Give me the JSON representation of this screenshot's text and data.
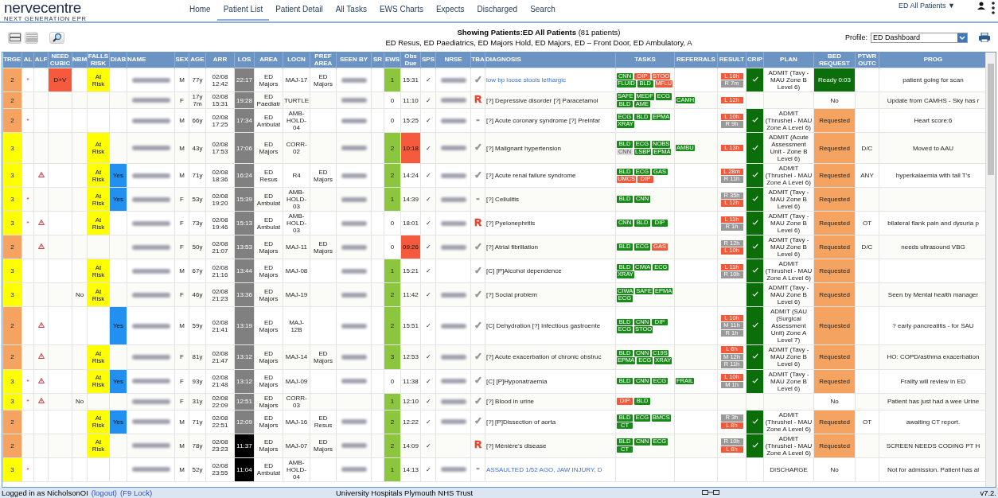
{
  "logo": {
    "name": "nervecentre",
    "tagline": "NEXT GENERATION EPR"
  },
  "nav": [
    {
      "label": "Home",
      "selected": false
    },
    {
      "label": "Patient List",
      "selected": true
    },
    {
      "label": "Patient Detail",
      "selected": false
    },
    {
      "label": "All Tasks",
      "selected": false
    },
    {
      "label": "EWS Charts",
      "selected": false
    },
    {
      "label": "Expects",
      "selected": false
    },
    {
      "label": "Discharged",
      "selected": false
    },
    {
      "label": "Search",
      "selected": false
    }
  ],
  "list_selector": "ED All Patients ▼",
  "heading": {
    "title": "Showing Patients:ED All Patients",
    "count": "(81 patients)",
    "areas": "ED Resus, ED Paediatrics, ED Majors Hold, ED Majors, ED – Front Door, ED Ambulatory, A"
  },
  "profile": {
    "label": "Profile:",
    "value": "ED Dashboard"
  },
  "table": {
    "columns": [
      "TRGE",
      "AL",
      "ALF",
      "NEED CUBIC",
      "NBM",
      "FALLS RISK",
      "DIAB",
      "NAME",
      "SEX",
      "AGE",
      "ARR",
      "LOS",
      "AREA",
      "LOCN",
      "PREF AREA",
      "SEEN BY",
      "SR",
      "EWS",
      "Obs Due",
      "SPS",
      "NRSE",
      "TBA",
      "DIAGNOSIS",
      "TASKS",
      "REFERRALS",
      "RESULT",
      "CRIP",
      "PLAN",
      "BED REQUEST",
      "PTWR OUTC",
      "PROG"
    ],
    "rows": [
      {
        "trge": {
          "text": "2",
          "color": "#f4a460"
        },
        "alc": "*",
        "alert": false,
        "need_cubicle": "D+V",
        "nbm": "",
        "falls_risk": "At Risk",
        "diab": "",
        "sex": "M",
        "age": "77y",
        "arr": "02/08 12:42",
        "los": {
          "text": "22:17",
          "color": "#808080"
        },
        "area": "ED Majors",
        "locn": "MAJ-17",
        "pref_area": "ED Majors",
        "seen_by_redacted": true,
        "ews": {
          "text": "1",
          "color": "#8cc63f"
        },
        "obs_due": "15:31",
        "obs_overdue": false,
        "sps": "✓",
        "nurse_redacted": true,
        "tba": {
          "text": "✓",
          "color": "#999999"
        },
        "diagnosis": "low bp loose stools lethargic",
        "diagnosis_link": true,
        "tasks": [
          {
            "label": "CNN",
            "color": "#1a8a1a"
          },
          {
            "label": "DIP",
            "color": "#f05a3c"
          },
          {
            "label": "STOO",
            "color": "#f05a3c"
          },
          {
            "label": "FLUID",
            "color": "#1a8a1a"
          },
          {
            "label": "BLD",
            "color": "#1a8a1a"
          },
          {
            "label": "MFLU",
            "color": "#f05a3c"
          }
        ],
        "referrals": [],
        "results": [
          {
            "label": "L 18h",
            "color": "#f05a3c"
          },
          {
            "label": "R 7m",
            "color": "#999999"
          }
        ],
        "crip": true,
        "plan": "ADMIT (Tavy - MAU Zone B Level 6)",
        "bed_request": {
          "text": "Ready 0:03",
          "color": "#0b6e0b"
        },
        "ptwr": "",
        "prog": "patient going for scan"
      },
      {
        "trge": {
          "text": "2",
          "color": "#f4a460"
        },
        "alc": "",
        "alert": false,
        "need_cubicle": "",
        "nbm": "",
        "falls_risk": "",
        "diab": "",
        "sex": "F",
        "age": "17y 7m",
        "arr": "02/08 15:31",
        "los": {
          "text": "19:28",
          "color": "#808080"
        },
        "area": "ED Paediatr",
        "locn": "TURTLE",
        "pref_area": "",
        "seen_by_redacted": true,
        "ews": {
          "text": "0",
          "color": "#ffffff"
        },
        "obs_due": "11:10",
        "obs_overdue": false,
        "sps": "✓",
        "nurse_redacted": true,
        "tba": {
          "text": "R",
          "color": "#e8402a"
        },
        "diagnosis": "[?] Depressive disorder [?] Paracetamol",
        "diagnosis_link": false,
        "tasks": [
          {
            "label": "SAFE",
            "color": "#1a8a1a"
          },
          {
            "label": "MEDF",
            "color": "#1a8a1a"
          },
          {
            "label": "ECG",
            "color": "#1a8a1a"
          },
          {
            "label": "BLD",
            "color": "#1a8a1a"
          },
          {
            "label": "AME",
            "color": "#1a8a1a"
          }
        ],
        "referrals": [
          "CAMH"
        ],
        "results": [
          {
            "label": "L 12h",
            "color": "#f05a3c"
          }
        ],
        "crip": false,
        "plan": "",
        "bed_request": {
          "text": "No",
          "color": "#ffffff"
        },
        "ptwr": "",
        "prog": "Update from CAMHS - Sky has r"
      },
      {
        "trge": {
          "text": "2",
          "color": "#f4a460"
        },
        "alc": "*",
        "alert": false,
        "need_cubicle": "",
        "nbm": "",
        "falls_risk": "",
        "diab": "",
        "sex": "M",
        "age": "66y",
        "arr": "02/08 17:25",
        "los": {
          "text": "17:34",
          "color": "#808080"
        },
        "area": "ED Ambulat",
        "locn": "AMB-HOLD-04",
        "pref_area": "",
        "seen_by_redacted": true,
        "ews": {
          "text": "0",
          "color": "#ffffff"
        },
        "obs_due": "15:25",
        "obs_overdue": false,
        "sps": "✓",
        "nurse_redacted": true,
        "tba": {
          "text": "-",
          "color": "#999999"
        },
        "diagnosis": "[?] Acute coronary syndrome [?] Preinfar",
        "diagnosis_link": false,
        "tasks": [
          {
            "label": "ECG",
            "color": "#1a8a1a"
          },
          {
            "label": "BLD",
            "color": "#1a8a1a"
          },
          {
            "label": "EPMA",
            "color": "#1a8a1a"
          },
          {
            "label": "XRAY",
            "color": "#1a8a1a"
          }
        ],
        "referrals": [],
        "results": [
          {
            "label": "L 10h",
            "color": "#f05a3c"
          },
          {
            "label": "R 9h",
            "color": "#999999"
          }
        ],
        "crip": true,
        "plan": "ADMIT (Thrushel - MAU Zone A Level 6)",
        "bed_request": {
          "text": "Requested",
          "color": "#f4a460"
        },
        "ptwr": "",
        "prog": "Heart score:6"
      },
      {
        "trge": {
          "text": "3",
          "color": "#ffff00"
        },
        "alc": "",
        "alert": false,
        "need_cubicle": "",
        "nbm": "",
        "falls_risk": "At Risk",
        "diab": "",
        "sex": "M",
        "age": "43y",
        "arr": "02/08 17:53",
        "los": {
          "text": "17:06",
          "color": "#808080"
        },
        "area": "ED Majors",
        "locn": "CORR-02",
        "pref_area": "",
        "seen_by_redacted": true,
        "ews": {
          "text": "2",
          "color": "#8cc63f"
        },
        "obs_due": "10:18",
        "obs_overdue": true,
        "sps": "✓",
        "nurse_redacted": true,
        "tba": {
          "text": "✓",
          "color": "#999999"
        },
        "diagnosis": "[?] Malignant hypertension",
        "diagnosis_link": false,
        "tasks": [
          {
            "label": "BLD",
            "color": "#1a8a1a"
          },
          {
            "label": "ECG",
            "color": "#1a8a1a"
          },
          {
            "label": "NOBS",
            "color": "#1a8a1a"
          },
          {
            "label": "CNN",
            "color": "#dddddd"
          },
          {
            "label": "LSBP",
            "color": "#1a8a1a"
          },
          {
            "label": "EPMA",
            "color": "#1a8a1a"
          }
        ],
        "referrals": [
          "AMBU"
        ],
        "results": [
          {
            "label": "L 13h",
            "color": "#f05a3c"
          }
        ],
        "crip": true,
        "plan": "ADMIT (Acute Assessment Unit - Zone B Level 6)",
        "bed_request": {
          "text": "Requested",
          "color": "#f4a460"
        },
        "ptwr": "D/C",
        "prog": "Moved to AAU"
      },
      {
        "trge": {
          "text": "3",
          "color": "#ffff00"
        },
        "alc": "",
        "alert": true,
        "need_cubicle": "",
        "nbm": "",
        "falls_risk": "At Risk",
        "diab": "Yes",
        "sex": "M",
        "age": "71y",
        "arr": "02/08 18:36",
        "los": {
          "text": "16:24",
          "color": "#808080"
        },
        "area": "ED Resus",
        "locn": "R4",
        "pref_area": "ED Majors",
        "seen_by_redacted": true,
        "ews": {
          "text": "2",
          "color": "#8cc63f"
        },
        "obs_due": "14:24",
        "obs_overdue": false,
        "sps": "✓",
        "nurse_redacted": true,
        "tba": {
          "text": "✓",
          "color": "#999999"
        },
        "diagnosis": "[?] Acute renal failure syndrome",
        "diagnosis_link": false,
        "tasks": [
          {
            "label": "BLD",
            "color": "#1a8a1a"
          },
          {
            "label": "ECG",
            "color": "#1a8a1a"
          },
          {
            "label": "GAS",
            "color": "#1a8a1a"
          },
          {
            "label": "UMCS",
            "color": "#f05a3c"
          },
          {
            "label": "DIP",
            "color": "#f05a3c"
          }
        ],
        "referrals": [],
        "results": [
          {
            "label": "L 28m",
            "color": "#f05a3c"
          },
          {
            "label": "R 11h",
            "color": "#999999"
          }
        ],
        "crip": true,
        "plan": "ADMIT (Thrushel - MAU Zone A Level 6)",
        "bed_request": {
          "text": "Requested",
          "color": "#f4a460"
        },
        "ptwr": "ANY",
        "prog": "hyperkalaemia with tall T's"
      },
      {
        "trge": {
          "text": "3",
          "color": "#ffff00"
        },
        "alc": "*",
        "alert": false,
        "need_cubicle": "",
        "nbm": "",
        "falls_risk": "At Risk",
        "diab": "Yes",
        "sex": "F",
        "age": "53y",
        "arr": "02/08 19:20",
        "los": {
          "text": "15:39",
          "color": "#808080"
        },
        "area": "ED Ambulat",
        "locn": "AMB-HOLD-03",
        "pref_area": "",
        "seen_by_redacted": true,
        "ews": {
          "text": "1",
          "color": "#8cc63f"
        },
        "obs_due": "14:39",
        "obs_overdue": false,
        "sps": "✓",
        "nurse_redacted": true,
        "tba": {
          "text": "-",
          "color": "#999999"
        },
        "diagnosis": "[?] Cellulitis",
        "diagnosis_link": false,
        "tasks": [
          {
            "label": "BLD",
            "color": "#1a8a1a"
          },
          {
            "label": "CNN",
            "color": "#1a8a1a"
          }
        ],
        "referrals": [],
        "results": [
          {
            "label": "R 35h",
            "color": "#999999"
          },
          {
            "label": "L 12h",
            "color": "#f05a3c"
          }
        ],
        "crip": true,
        "plan": "ADMIT (Tavy - MAU Zone B Level 6)",
        "bed_request": {
          "text": "Requested",
          "color": "#f4a460"
        },
        "ptwr": "",
        "prog": ""
      },
      {
        "trge": {
          "text": "3",
          "color": "#ffff00"
        },
        "alc": "*",
        "alert": true,
        "need_cubicle": "",
        "nbm": "",
        "falls_risk": "At Risk",
        "diab": "",
        "sex": "F",
        "age": "73y",
        "arr": "02/08 19:46",
        "los": {
          "text": "15:13",
          "color": "#808080"
        },
        "area": "ED Ambulat",
        "locn": "AMB-HOLD-03",
        "pref_area": "",
        "seen_by_redacted": true,
        "ews": {
          "text": "0",
          "color": "#ffffff"
        },
        "obs_due": "18:01",
        "obs_overdue": false,
        "sps": "✓",
        "nurse_redacted": true,
        "tba": {
          "text": "R",
          "color": "#e8402a"
        },
        "diagnosis": "[?] Pyelonephritis",
        "diagnosis_link": false,
        "tasks": [
          {
            "label": "CNN",
            "color": "#1a8a1a"
          },
          {
            "label": "BLD",
            "color": "#1a8a1a"
          },
          {
            "label": "DIP",
            "color": "#1a8a1a"
          }
        ],
        "referrals": [],
        "results": [
          {
            "label": "L 11h",
            "color": "#f05a3c"
          },
          {
            "label": "R 1h",
            "color": "#999999"
          }
        ],
        "crip": true,
        "plan": "ADMIT (Tavy - MAU Zone B Level 6)",
        "bed_request": {
          "text": "Requested",
          "color": "#f4a460"
        },
        "ptwr": "OT",
        "prog": "bilateral flank pain and dysuria p"
      },
      {
        "trge": {
          "text": "2",
          "color": "#f4a460"
        },
        "alc": "",
        "alert": true,
        "need_cubicle": "",
        "nbm": "",
        "falls_risk": "",
        "diab": "",
        "sex": "F",
        "age": "50y",
        "arr": "02/08 21:07",
        "los": {
          "text": "13:53",
          "color": "#808080"
        },
        "area": "ED Majors",
        "locn": "MAJ-11",
        "pref_area": "ED Majors",
        "seen_by_redacted": true,
        "ews": {
          "text": "0",
          "color": "#ffffff"
        },
        "obs_due": "09:26",
        "obs_overdue": true,
        "sps": "✓",
        "nurse_redacted": true,
        "tba": {
          "text": "✓",
          "color": "#999999"
        },
        "diagnosis": "[?] Atrial fibrillation",
        "diagnosis_link": false,
        "tasks": [
          {
            "label": "BLD",
            "color": "#1a8a1a"
          },
          {
            "label": "ECG",
            "color": "#1a8a1a"
          },
          {
            "label": "GAS",
            "color": "#f05a3c"
          }
        ],
        "referrals": [],
        "results": [
          {
            "label": "R 12h",
            "color": "#999999"
          },
          {
            "label": "L 10h",
            "color": "#f05a3c"
          }
        ],
        "crip": true,
        "plan": "ADMIT (Tavy - MAU Zone B Level 6)",
        "bed_request": {
          "text": "Requested",
          "color": "#f4a460"
        },
        "ptwr": "D/C",
        "prog": "needs ultrasound VBG"
      },
      {
        "trge": {
          "text": "3",
          "color": "#ffff00"
        },
        "alc": "",
        "alert": false,
        "need_cubicle": "",
        "nbm": "",
        "falls_risk": "At Risk",
        "diab": "",
        "sex": "M",
        "age": "67y",
        "arr": "02/08 21:16",
        "los": {
          "text": "13:44",
          "color": "#808080"
        },
        "area": "ED Majors",
        "locn": "MAJ-08",
        "pref_area": "",
        "seen_by_redacted": true,
        "ews": {
          "text": "1",
          "color": "#8cc63f"
        },
        "obs_due": "15:21",
        "obs_overdue": false,
        "sps": "✓",
        "nurse_redacted": false,
        "tba": {
          "text": "✓",
          "color": "#999999"
        },
        "diagnosis": "[C] [P]Alcohol dependence",
        "diagnosis_link": false,
        "tasks": [
          {
            "label": "BLD",
            "color": "#1a8a1a"
          },
          {
            "label": "CIWA",
            "color": "#1a8a1a"
          },
          {
            "label": "ECG",
            "color": "#1a8a1a"
          },
          {
            "label": "XRAY",
            "color": "#1a8a1a"
          }
        ],
        "referrals": [],
        "results": [
          {
            "label": "L 11h",
            "color": "#f05a3c"
          },
          {
            "label": "R 10h",
            "color": "#999999"
          }
        ],
        "crip": true,
        "plan": "ADMIT (Thrushel - MAU Zone A Level 6)",
        "bed_request": {
          "text": "Requested",
          "color": "#f4a460"
        },
        "ptwr": "",
        "prog": ""
      },
      {
        "trge": {
          "text": "3",
          "color": "#ffff00"
        },
        "alc": "",
        "alert": false,
        "need_cubicle": "",
        "nbm": "No",
        "falls_risk": "At Risk",
        "diab": "",
        "sex": "F",
        "age": "46y",
        "arr": "02/08 21:23",
        "los": {
          "text": "13:36",
          "color": "#808080"
        },
        "area": "ED Majors",
        "locn": "MAJ-19",
        "pref_area": "",
        "seen_by_redacted": true,
        "ews": {
          "text": "2",
          "color": "#8cc63f"
        },
        "obs_due": "11:42",
        "obs_overdue": false,
        "sps": "✓",
        "nurse_redacted": true,
        "tba": {
          "text": "✓",
          "color": "#999999"
        },
        "diagnosis": "[?] Social problem",
        "diagnosis_link": false,
        "tasks": [
          {
            "label": "CIWA",
            "color": "#1a8a1a"
          },
          {
            "label": "SAFE",
            "color": "#1a8a1a"
          },
          {
            "label": "EPMA",
            "color": "#1a8a1a"
          },
          {
            "label": "ECG",
            "color": "#1a8a1a"
          }
        ],
        "referrals": [],
        "results": [],
        "crip": true,
        "plan": "ADMIT (Tavy - MAU Zone B Level 6)",
        "bed_request": {
          "text": "Requested",
          "color": "#f4a460"
        },
        "ptwr": "",
        "prog": "Seen by Mental health manager"
      },
      {
        "trge": {
          "text": "2",
          "color": "#f4a460"
        },
        "alc": "",
        "alert": true,
        "need_cubicle": "",
        "nbm": "",
        "falls_risk": "",
        "diab": "Yes",
        "sex": "M",
        "age": "59y",
        "arr": "02/08 21:41",
        "los": {
          "text": "13:19",
          "color": "#808080"
        },
        "area": "ED Majors",
        "locn": "MAJ-12B",
        "pref_area": "",
        "seen_by_redacted": true,
        "ews": {
          "text": "2",
          "color": "#8cc63f"
        },
        "obs_due": "15:51",
        "obs_overdue": false,
        "sps": "✓",
        "nurse_redacted": true,
        "tba": {
          "text": "✓",
          "color": "#999999"
        },
        "diagnosis": "[C] Dehydration [?] Infectious gastroente",
        "diagnosis_link": false,
        "tasks": [
          {
            "label": "BLD",
            "color": "#1a8a1a"
          },
          {
            "label": "CNN",
            "color": "#1a8a1a"
          },
          {
            "label": "DIP",
            "color": "#1a8a1a"
          },
          {
            "label": "ECG",
            "color": "#1a8a1a"
          },
          {
            "label": "STOO",
            "color": "#1a8a1a"
          }
        ],
        "referrals": [],
        "results": [
          {
            "label": "L 10h",
            "color": "#f05a3c"
          },
          {
            "label": "M 11h",
            "color": "#999999"
          },
          {
            "label": "R 1h",
            "color": "#999999"
          }
        ],
        "crip": true,
        "plan": "ADMIT (SAU (Surgical Assessment Unit) Zone A Level 7)",
        "bed_request": {
          "text": "Requested",
          "color": "#f4a460"
        },
        "ptwr": "",
        "prog": "? early pancreatitis - for SAU"
      },
      {
        "trge": {
          "text": "2",
          "color": "#f4a460"
        },
        "alc": "",
        "alert": true,
        "need_cubicle": "",
        "nbm": "",
        "falls_risk": "At Risk",
        "diab": "",
        "sex": "F",
        "age": "81y",
        "arr": "02/08 21:47",
        "los": {
          "text": "13:12",
          "color": "#808080"
        },
        "area": "ED Majors",
        "locn": "MAJ-14",
        "pref_area": "ED Majors",
        "seen_by_redacted": true,
        "ews": {
          "text": "3",
          "color": "#8cc63f"
        },
        "obs_due": "12:53",
        "obs_overdue": false,
        "sps": "✓",
        "nurse_redacted": true,
        "tba": {
          "text": "✓",
          "color": "#999999"
        },
        "diagnosis": "[?] Acute exacerbation of chronic obstruc",
        "diagnosis_link": false,
        "tasks": [
          {
            "label": "BLD",
            "color": "#1a8a1a"
          },
          {
            "label": "CNN",
            "color": "#1a8a1a"
          },
          {
            "label": "C19S",
            "color": "#1a8a1a"
          },
          {
            "label": "EPMA",
            "color": "#1a8a1a"
          },
          {
            "label": "ECG",
            "color": "#1a8a1a"
          },
          {
            "label": "XRAY",
            "color": "#1a8a1a"
          }
        ],
        "referrals": [],
        "results": [
          {
            "label": "L 6h",
            "color": "#f05a3c"
          },
          {
            "label": "M 12h",
            "color": "#999999"
          },
          {
            "label": "R 11h",
            "color": "#999999"
          }
        ],
        "crip": true,
        "plan": "ADMIT (Tavy - MAU Zone B Level 6)",
        "bed_request": {
          "text": "Requested",
          "color": "#f4a460"
        },
        "ptwr": "",
        "prog": "HO: COPD/asthma exacerbation"
      },
      {
        "trge": {
          "text": "3",
          "color": "#ffff00"
        },
        "alc": "*",
        "alert": true,
        "need_cubicle": "",
        "nbm": "",
        "falls_risk": "At Risk",
        "diab": "Yes",
        "sex": "F",
        "age": "93y",
        "arr": "02/08 21:48",
        "los": {
          "text": "13:12",
          "color": "#808080"
        },
        "area": "ED Majors",
        "locn": "MAJ-09",
        "pref_area": "",
        "seen_by_redacted": true,
        "ews": {
          "text": "0",
          "color": "#ffffff"
        },
        "obs_due": "11:38",
        "obs_overdue": false,
        "sps": "✓",
        "nurse_redacted": true,
        "tba": {
          "text": "✓",
          "color": "#999999"
        },
        "diagnosis": "[C] [P]Hyponatraemia",
        "diagnosis_link": false,
        "tasks": [
          {
            "label": "BLD",
            "color": "#1a8a1a"
          },
          {
            "label": "CNN",
            "color": "#1a8a1a"
          },
          {
            "label": "ECG",
            "color": "#1a8a1a"
          }
        ],
        "referrals": [
          "FRAIL"
        ],
        "results": [
          {
            "label": "L 10h",
            "color": "#f05a3c"
          },
          {
            "label": "M 1h",
            "color": "#999999"
          }
        ],
        "crip": true,
        "plan": "ADMIT (Tavy - MAU Zone B Level 6)",
        "bed_request": {
          "text": "Requested",
          "color": "#f4a460"
        },
        "ptwr": "",
        "prog": "Frailty will review in ED"
      },
      {
        "trge": {
          "text": "3",
          "color": "#ffff00"
        },
        "alc": "*",
        "alert": true,
        "need_cubicle": "",
        "nbm": "No",
        "falls_risk": "",
        "diab": "",
        "sex": "F",
        "age": "31y",
        "arr": "02/08 22:09",
        "los": {
          "text": "12:51",
          "color": "#808080"
        },
        "area": "ED Majors",
        "locn": "CORR-03",
        "pref_area": "",
        "seen_by_redacted": false,
        "ews": {
          "text": "1",
          "color": "#8cc63f"
        },
        "obs_due": "12:10",
        "obs_overdue": false,
        "sps": "✓",
        "nurse_redacted": true,
        "tba": {
          "text": "✓",
          "color": "#999999"
        },
        "diagnosis": "[?] Blood in urine",
        "diagnosis_link": false,
        "tasks": [
          {
            "label": "DIP",
            "color": "#f05a3c"
          },
          {
            "label": "BLD",
            "color": "#1a8a1a"
          }
        ],
        "referrals": [],
        "results": [],
        "crip": false,
        "plan": "",
        "bed_request": {
          "text": "No",
          "color": "#ffffff"
        },
        "ptwr": "",
        "prog": "Patient has just had a wee Urine"
      },
      {
        "trge": {
          "text": "2",
          "color": "#f4a460"
        },
        "alc": "",
        "alert": false,
        "need_cubicle": "",
        "nbm": "",
        "falls_risk": "At Risk",
        "diab": "Yes",
        "sex": "M",
        "age": "71y",
        "arr": "02/08 22:51",
        "los": {
          "text": "12:09",
          "color": "#808080"
        },
        "area": "ED Majors",
        "locn": "MAJ-16",
        "pref_area": "ED Resus",
        "seen_by_redacted": true,
        "ews": {
          "text": "2",
          "color": "#8cc63f"
        },
        "obs_due": "12:22",
        "obs_overdue": false,
        "sps": "✓",
        "nurse_redacted": true,
        "tba": {
          "text": "✓",
          "color": "#999999"
        },
        "diagnosis": "[?] [P]Dissection of aorta",
        "diagnosis_link": false,
        "tasks": [
          {
            "label": "BLD",
            "color": "#1a8a1a"
          },
          {
            "label": "ECG",
            "color": "#1a8a1a"
          },
          {
            "label": "BMCS",
            "color": "#1a8a1a"
          },
          {
            "label": "CT",
            "color": "#1a8a1a"
          }
        ],
        "referrals": [],
        "results": [
          {
            "label": "R 3h",
            "color": "#999999"
          },
          {
            "label": "L 8h",
            "color": "#f05a3c"
          }
        ],
        "crip": true,
        "plan": "ADMIT (Thrushel - MAU Zone A Level 6)",
        "bed_request": {
          "text": "Requested",
          "color": "#f4a460"
        },
        "ptwr": "OT",
        "prog": "awaiting CT report."
      },
      {
        "trge": {
          "text": "2",
          "color": "#f4a460"
        },
        "alc": "",
        "alert": false,
        "need_cubicle": "",
        "nbm": "",
        "falls_risk": "At Risk",
        "diab": "",
        "sex": "M",
        "age": "78y",
        "arr": "02/08 23:23",
        "los": {
          "text": "11:37",
          "color": "#000000"
        },
        "area": "ED Majors",
        "locn": "MAJ-07",
        "pref_area": "ED Majors",
        "seen_by_redacted": true,
        "ews": {
          "text": "2",
          "color": "#8cc63f"
        },
        "obs_due": "14:09",
        "obs_overdue": false,
        "sps": "✓",
        "nurse_redacted": false,
        "tba": {
          "text": "R",
          "color": "#e8402a"
        },
        "diagnosis": "[?] Ménière's disease",
        "diagnosis_link": false,
        "tasks": [
          {
            "label": "BLD",
            "color": "#1a8a1a"
          },
          {
            "label": "CNN",
            "color": "#1a8a1a"
          },
          {
            "label": "ECG",
            "color": "#1a8a1a"
          },
          {
            "label": "CT",
            "color": "#1a8a1a"
          }
        ],
        "referrals": [],
        "results": [
          {
            "label": "R 10h",
            "color": "#999999"
          },
          {
            "label": "L 8h",
            "color": "#f05a3c"
          }
        ],
        "crip": true,
        "plan": "ADMIT (Thrushel - MAU Zone A Level 6)",
        "bed_request": {
          "text": "Requested",
          "color": "#f4a460"
        },
        "ptwr": "",
        "prog": "SCREEN NEEDS CODING PT H"
      },
      {
        "trge": {
          "text": "3",
          "color": "#ffff00"
        },
        "alc": "*",
        "alert": false,
        "need_cubicle": "",
        "nbm": "",
        "falls_risk": "",
        "diab": "",
        "sex": "M",
        "age": "52y",
        "arr": "02/08 23:55",
        "los": {
          "text": "11:04",
          "color": "#000000"
        },
        "area": "ED Ambulat",
        "locn": "AMB-HOLD-04",
        "pref_area": "",
        "seen_by_redacted": true,
        "ews": {
          "text": "1",
          "color": "#8cc63f"
        },
        "obs_due": "14:13",
        "obs_overdue": false,
        "sps": "✓",
        "nurse_redacted": true,
        "tba": {
          "text": "-",
          "color": "#999999"
        },
        "diagnosis": "ASSAULTED 1/52 AGO, JAW INJURY, D",
        "diagnosis_link": true,
        "tasks": [],
        "referrals": [],
        "results": [],
        "crip": false,
        "plan": "DISCHARGE",
        "bed_request": {
          "text": "No",
          "color": "#ffffff"
        },
        "ptwr": "",
        "prog": "Not for admission. Patient has al"
      }
    ]
  },
  "footer": {
    "user": "Logged in as NicholsonOI",
    "logout": "(logout)",
    "lock": "(F9 Lock)",
    "trust": "University Hospitals Plymouth NHS Trust",
    "version": "v7.2."
  }
}
